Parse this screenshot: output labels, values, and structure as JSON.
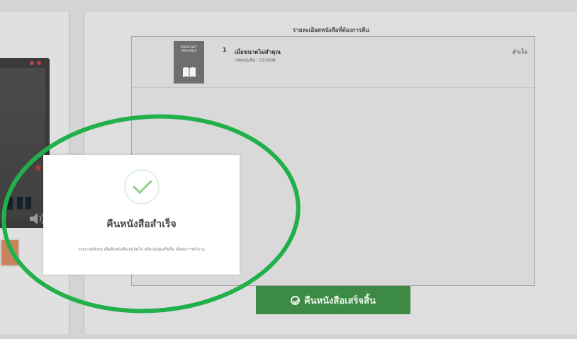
{
  "books_panel": {
    "title": "รายละเอียดหนังสือที่ต้องการคืน",
    "items": [
      {
        "index": "1",
        "cover_text": "IMAGE NOT AVAILABLE",
        "title": "เมื่อขนาดไม่สำคุณ",
        "code_label": "รหัสหนังสือ : 031008",
        "status": "สำเร็จ"
      }
    ]
  },
  "finish_button": {
    "label": "คืนหนังสือเสร็จสิ้น",
    "icon": "check-circle-icon"
  },
  "modal": {
    "icon": "check-icon",
    "title": "คืนหนังสือสำเร็จ",
    "description": "กรุณากดลักครู เพื่อคืนหนังสือเล่มถัดไป หรือกดปุ่มเสร็จสิ้น เพื่อจบการทำงาน"
  },
  "colors": {
    "accent_green": "#3d8a45",
    "annotation_green": "#22b04b",
    "check_green": "#8fd08a"
  }
}
